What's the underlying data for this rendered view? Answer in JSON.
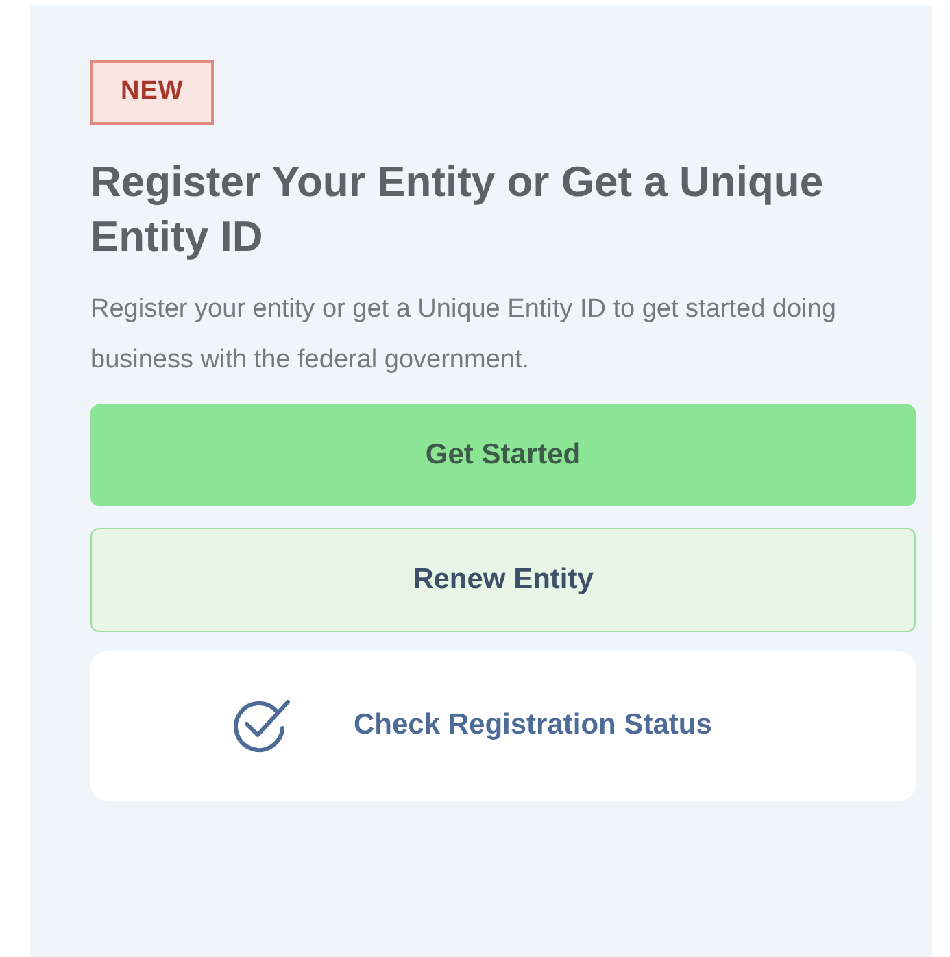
{
  "badge": "NEW",
  "title": "Register Your Entity or Get a Unique Entity ID",
  "description": "Register your entity or get a Unique Entity ID to get started doing business with the federal government.",
  "actions": [
    {
      "kind": "primary",
      "label": "Get Started"
    },
    {
      "kind": "secondary",
      "label": "Renew Entity"
    },
    {
      "kind": "status",
      "label": "Check Registration Status"
    }
  ]
}
